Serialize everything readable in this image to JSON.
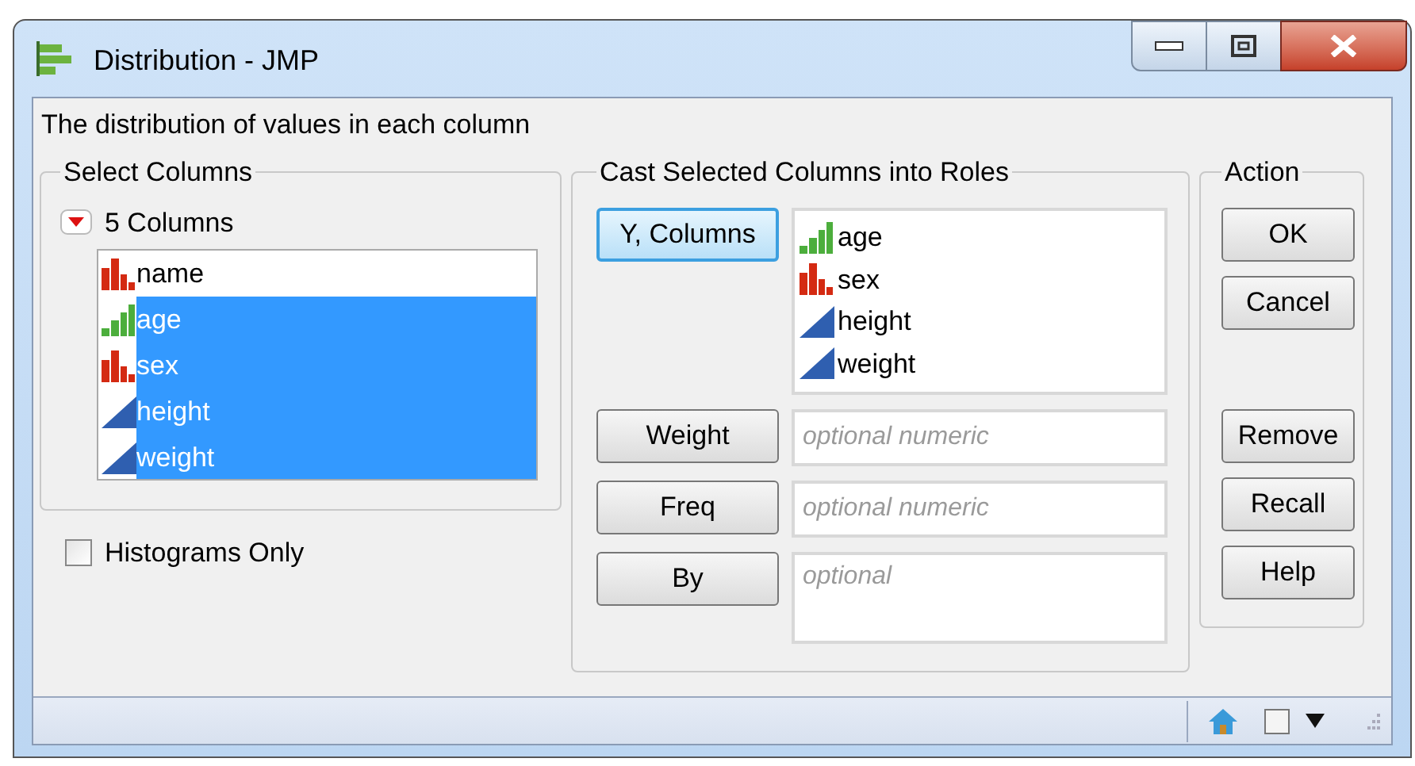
{
  "window": {
    "title": "Distribution - JMP"
  },
  "description": "The distribution of values in each column",
  "select_columns": {
    "title": "Select Columns",
    "count_label": "5 Columns",
    "columns": [
      {
        "name": "name",
        "kind": "nominal",
        "selected": false
      },
      {
        "name": "age",
        "kind": "ordinal",
        "selected": true
      },
      {
        "name": "sex",
        "kind": "nominal",
        "selected": true
      },
      {
        "name": "height",
        "kind": "continuous",
        "selected": true
      },
      {
        "name": "weight",
        "kind": "continuous",
        "selected": true
      }
    ]
  },
  "histograms_only": {
    "label": "Histograms Only",
    "checked": false
  },
  "cast": {
    "title": "Cast Selected Columns into Roles",
    "roles": [
      {
        "button": "Y, Columns",
        "focused": true,
        "items": [
          {
            "name": "age",
            "kind": "ordinal"
          },
          {
            "name": "sex",
            "kind": "nominal"
          },
          {
            "name": "height",
            "kind": "continuous"
          },
          {
            "name": "weight",
            "kind": "continuous"
          }
        ]
      },
      {
        "button": "Weight",
        "focused": false,
        "placeholder": "optional numeric"
      },
      {
        "button": "Freq",
        "focused": false,
        "placeholder": "optional numeric"
      },
      {
        "button": "By",
        "focused": false,
        "placeholder": "optional",
        "tall": true
      }
    ]
  },
  "action": {
    "title": "Action",
    "groups": [
      [
        "OK",
        "Cancel"
      ],
      [
        "Remove",
        "Recall",
        "Help"
      ]
    ]
  }
}
